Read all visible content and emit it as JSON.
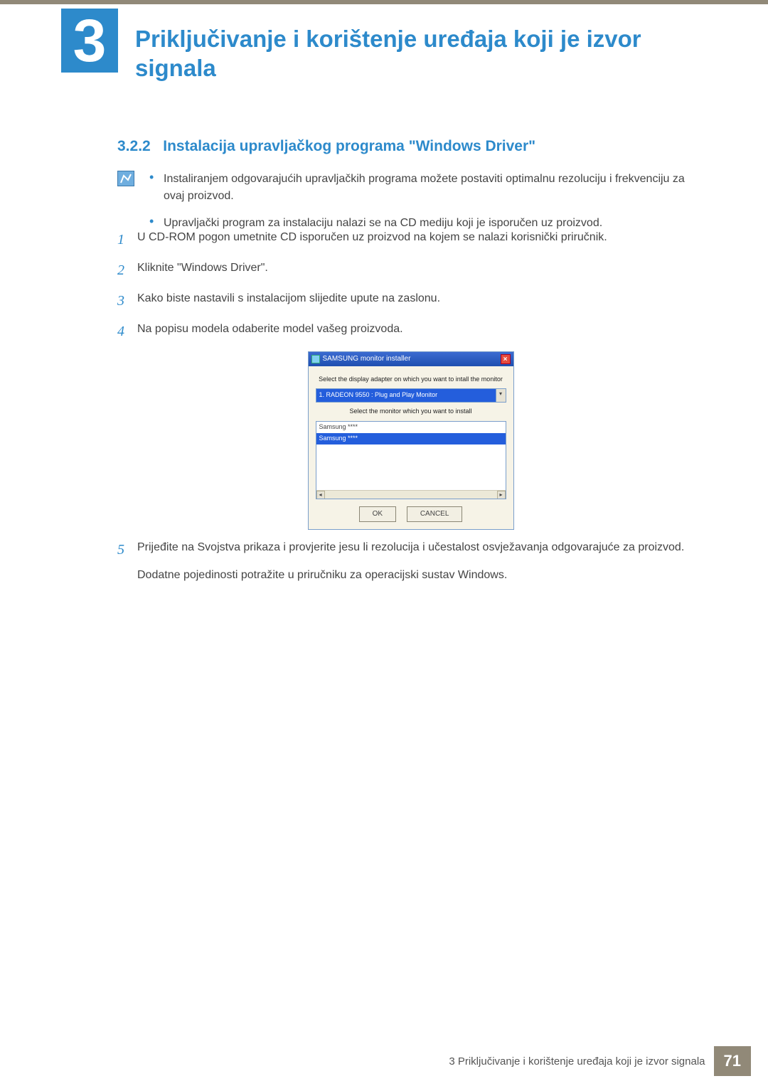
{
  "chapter": {
    "number": "3",
    "title": "Priključivanje i korištenje uređaja koji je izvor signala"
  },
  "section": {
    "number": "3.2.2",
    "title": "Instalacija upravljačkog programa \"Windows Driver\""
  },
  "notes": [
    "Instaliranjem odgovarajućih upravljačkih programa možete postaviti optimalnu rezoluciju i frekvenciju za ovaj proizvod.",
    "Upravljački program za instalaciju nalazi se na CD mediju koji je isporučen uz proizvod."
  ],
  "steps": {
    "1": "U CD-ROM pogon umetnite CD isporučen uz proizvod na kojem se nalazi korisnički priručnik.",
    "2": "Kliknite \"Windows Driver\".",
    "3": "Kako biste nastavili s instalacijom slijedite upute na zaslonu.",
    "4": "Na popisu modela odaberite model vašeg proizvoda.",
    "5": "Prijeđite na Svojstva prikaza i provjerite jesu li rezolucija i učestalost osvježavanja odgovarajuće za proizvod.",
    "5b": "Dodatne pojedinosti potražite u priručniku za operacijski sustav Windows."
  },
  "installer": {
    "title": "SAMSUNG monitor installer",
    "label_adapter": "Select the display adapter on which you want to intall the monitor",
    "adapter_selected": "1. RADEON 9550 : Plug and Play Monitor",
    "label_monitor": "Select the monitor which you want to install",
    "list": {
      "item0": "Samsung ****",
      "item1": "Samsung ****"
    },
    "ok": "OK",
    "cancel": "CANCEL"
  },
  "footer": {
    "text": "3 Priključivanje i korištenje uređaja koji je izvor signala",
    "page": "71"
  }
}
